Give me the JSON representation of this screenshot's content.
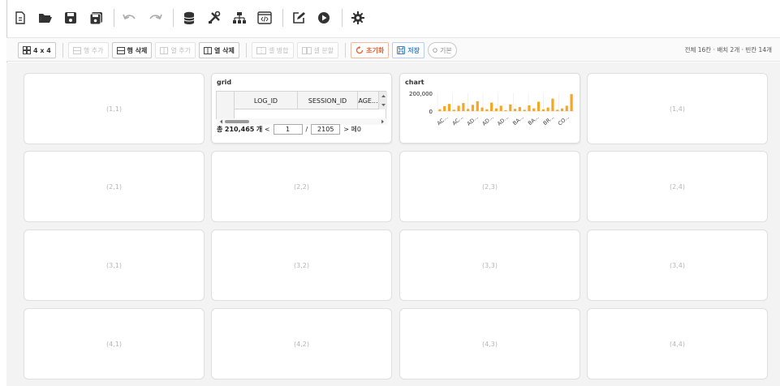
{
  "toolbar": {
    "icons": [
      "new-file-icon",
      "open-folder-icon",
      "save-icon",
      "save-all-icon",
      "undo-icon",
      "redo-icon",
      "database-icon",
      "tools-icon",
      "hierarchy-icon",
      "code-icon",
      "edit-icon",
      "run-icon",
      "settings-icon"
    ]
  },
  "layout_toolbar": {
    "grid_size": "4 x 4",
    "add_row": "행 추가",
    "delete_row": "행 삭제",
    "add_col": "열 추가",
    "delete_col": "열 삭제",
    "merge_cells": "셀 병합",
    "split_cell": "셀 분할",
    "reset": "초기화",
    "save": "저장",
    "default": "기본",
    "stats": "전체 16칸 · 배치 2개 · 빈칸 14개"
  },
  "cells": [
    {
      "label": "(1,1)"
    },
    {
      "label": "(1,4)"
    },
    {
      "label": "(2,1)"
    },
    {
      "label": "(2,2)"
    },
    {
      "label": "(2,3)"
    },
    {
      "label": "(2,4)"
    },
    {
      "label": "(3,1)"
    },
    {
      "label": "(3,2)"
    },
    {
      "label": "(3,3)"
    },
    {
      "label": "(3,4)"
    },
    {
      "label": "(4,1)"
    },
    {
      "label": "(4,2)"
    },
    {
      "label": "(4,3)"
    },
    {
      "label": "(4,4)"
    }
  ],
  "grid_widget": {
    "title": "grid",
    "columns": [
      "LOG_ID",
      "SESSION_ID",
      "AGE..."
    ],
    "total_prefix": "총",
    "total_count": "210,465",
    "total_suffix": "개",
    "prev": "<",
    "page": "1",
    "slash": "/",
    "page_total": "2105",
    "next": ">",
    "trailing": "페0"
  },
  "chart_widget": {
    "title": "chart",
    "y_tick_top": "200,000",
    "y_tick_zero": "0",
    "accent": "#f5a623"
  },
  "chart_data": {
    "type": "bar",
    "categories": [
      "AC...",
      "AC...",
      "AD...",
      "AD...",
      "AD...",
      "BA...",
      "BA...",
      "BR...",
      "CO..."
    ],
    "values": [
      20000,
      55000,
      80000,
      15000,
      60000,
      90000,
      25000,
      70000,
      110000,
      40000,
      20000,
      95000,
      30000,
      60000,
      10000,
      75000,
      25000,
      45000,
      15000,
      65000,
      30000,
      105000,
      20000,
      40000,
      140000,
      15000,
      30000,
      60000,
      190000
    ],
    "ylim": [
      0,
      200000
    ],
    "yticks": [
      "0",
      "200,000"
    ],
    "visible_x_labels": [
      "AC...",
      "AC...",
      "AD...",
      "AD...",
      "AD...",
      "BA...",
      "BA...",
      "BR...",
      "CO..."
    ]
  }
}
